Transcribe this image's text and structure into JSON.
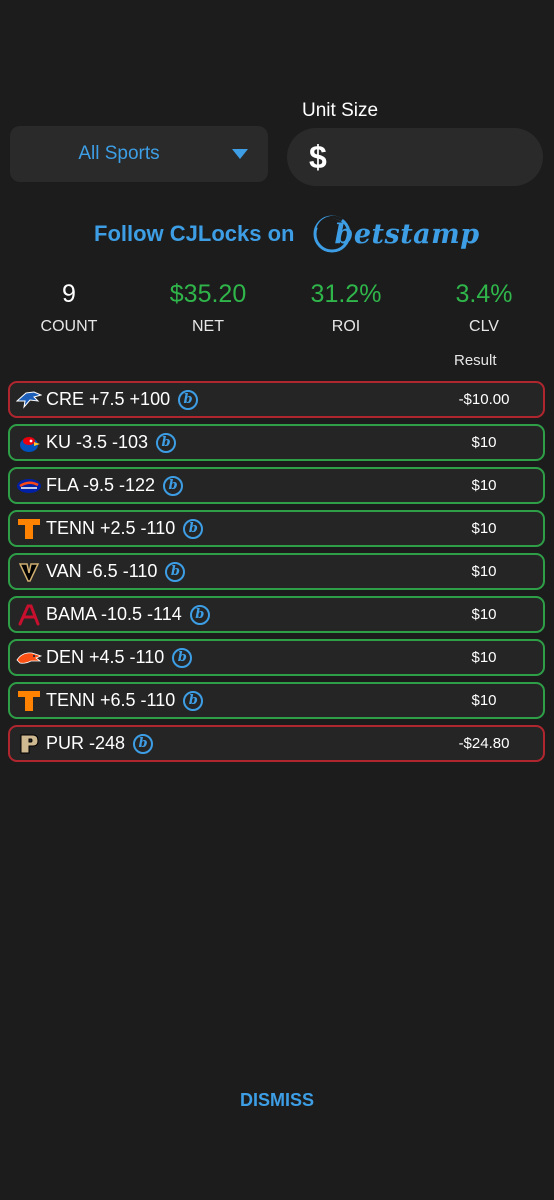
{
  "filters": {
    "sport_label": "All Sports",
    "unit_size_label": "Unit Size",
    "unit_size_currency": "$",
    "unit_size_value": ""
  },
  "follow": {
    "text": "Follow CJLocks on",
    "brand": "betstamp"
  },
  "stats": [
    {
      "value": "9",
      "label": "COUNT"
    },
    {
      "value": "$35.20",
      "label": "NET"
    },
    {
      "value": "31.2%",
      "label": "ROI"
    },
    {
      "value": "3.4%",
      "label": "CLV"
    }
  ],
  "result_header": "Result",
  "bets": [
    {
      "team_icon": "creighton-bluejay-icon",
      "text": "CRE +7.5 +100",
      "result": "-$10.00",
      "status": "loss"
    },
    {
      "team_icon": "kansas-jayhawk-icon",
      "text": "KU -3.5 -103",
      "result": "$10",
      "status": "win"
    },
    {
      "team_icon": "florida-gator-icon",
      "text": "FLA -9.5 -122",
      "result": "$10",
      "status": "win"
    },
    {
      "team_icon": "tennessee-t-icon",
      "text": "TENN +2.5 -110",
      "result": "$10",
      "status": "win"
    },
    {
      "team_icon": "vanderbilt-v-icon",
      "text": "VAN -6.5 -110",
      "result": "$10",
      "status": "win"
    },
    {
      "team_icon": "alabama-a-icon",
      "text": "BAMA -10.5 -114",
      "result": "$10",
      "status": "win"
    },
    {
      "team_icon": "denver-broncos-icon",
      "text": "DEN +4.5 -110",
      "result": "$10",
      "status": "win"
    },
    {
      "team_icon": "tennessee-t-icon",
      "text": "TENN +6.5 -110",
      "result": "$10",
      "status": "win"
    },
    {
      "team_icon": "purdue-p-icon",
      "text": "PUR -248",
      "result": "-$24.80",
      "status": "loss"
    }
  ],
  "dismiss_label": "DISMISS",
  "colors": {
    "background": "#1c1c1c",
    "accent": "#3d9ee5",
    "win": "#2e9e47",
    "loss": "#b0262e",
    "positive_stat": "#2fb54a"
  }
}
